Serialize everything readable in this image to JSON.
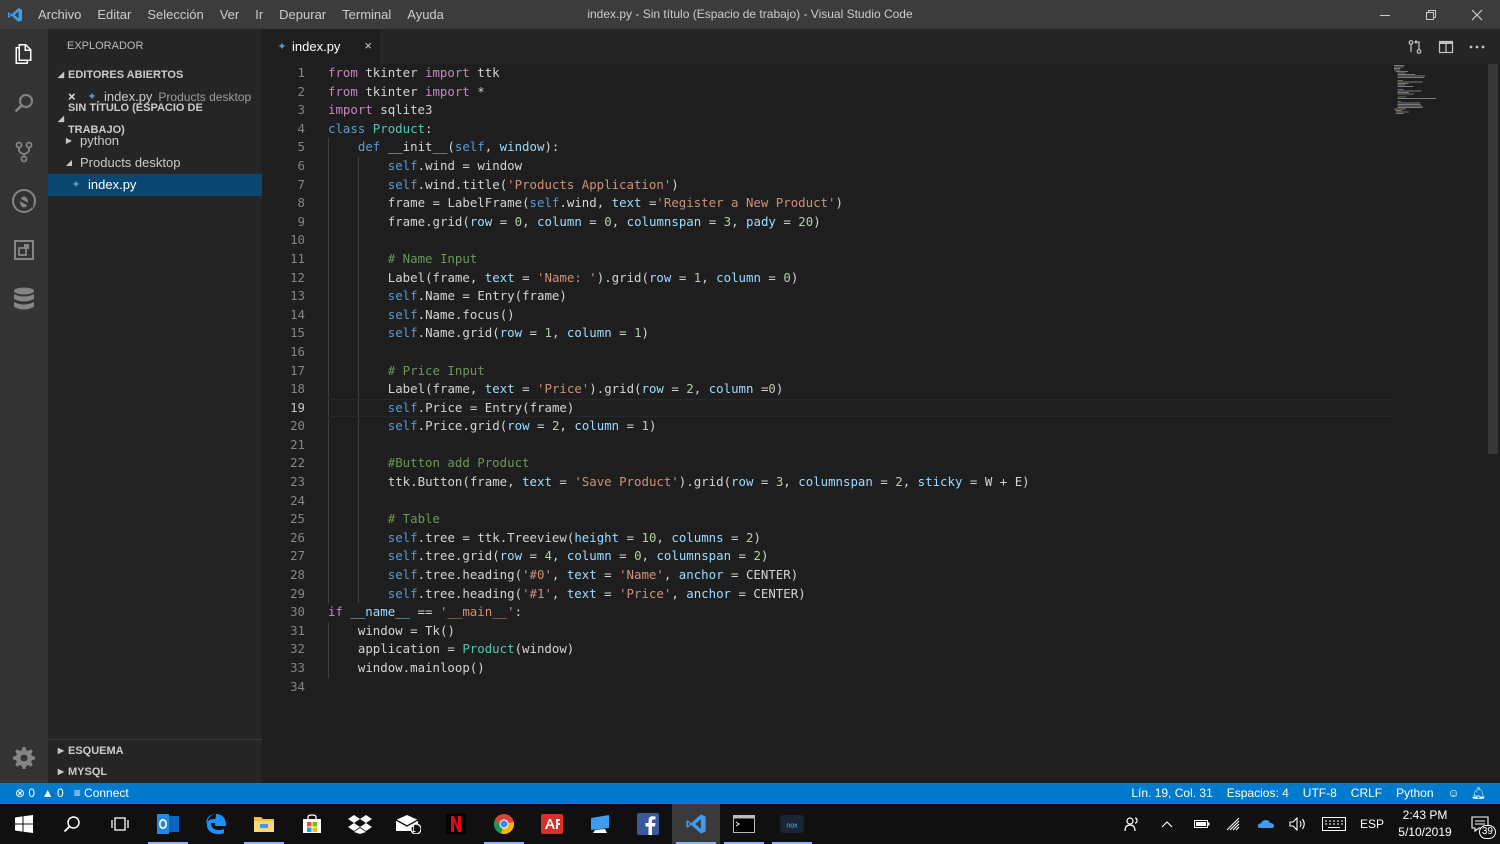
{
  "window": {
    "title": "index.py - Sin título (Espacio de trabajo) - Visual Studio Code",
    "menu": [
      "Archivo",
      "Editar",
      "Selección",
      "Ver",
      "Ir",
      "Depurar",
      "Terminal",
      "Ayuda"
    ]
  },
  "sidebar": {
    "title": "EXPLORADOR",
    "open_editors": {
      "header": "EDITORES ABIERTOS",
      "items": [
        {
          "name": "index.py",
          "description": "Products desktop"
        }
      ]
    },
    "workspace": {
      "header": "SIN TÍTULO (ESPACIO DE TRABAJO)",
      "items": [
        {
          "name": "python",
          "type": "folder",
          "expanded": false
        },
        {
          "name": "Products desktop",
          "type": "folder",
          "expanded": true
        },
        {
          "name": "index.py",
          "type": "file",
          "selected": true
        }
      ]
    },
    "bottom_sections": [
      "ESQUEMA",
      "MYSQL"
    ]
  },
  "editor": {
    "tab": {
      "label": "index.py",
      "close": "×"
    },
    "active_line": 19,
    "line_numbers": [
      "1",
      "2",
      "3",
      "4",
      "5",
      "6",
      "7",
      "8",
      "9",
      "10",
      "11",
      "12",
      "13",
      "14",
      "15",
      "16",
      "17",
      "18",
      "19",
      "20",
      "21",
      "22",
      "23",
      "24",
      "25",
      "26",
      "27",
      "28",
      "29",
      "30",
      "31",
      "32",
      "33",
      "34"
    ],
    "lines": [
      "from tkinter import ttk",
      "from tkinter import *",
      "import sqlite3",
      "class Product:",
      "    def __init__(self, window):",
      "        self.wind = window",
      "        self.wind.title('Products Application')",
      "        frame = LabelFrame(self.wind, text ='Register a New Product')",
      "        frame.grid(row = 0, column = 0, columnspan = 3, pady = 20)",
      "",
      "        # Name Input",
      "        Label(frame, text = 'Name: ').grid(row = 1, column = 0)",
      "        self.Name = Entry(frame)",
      "        self.Name.focus()",
      "        self.Name.grid(row = 1, column = 1)",
      "",
      "        # Price Input",
      "        Label(frame, text = 'Price').grid(row = 2, column =0)",
      "        self.Price = Entry(frame)",
      "        self.Price.grid(row = 2, column = 1)",
      "",
      "        #Button add Product",
      "        ttk.Button(frame, text = 'Save Product').grid(row = 3, columnspan = 2, sticky = W + E)",
      "",
      "        # Table",
      "        self.tree = ttk.Treeview(height = 10, columns = 2)",
      "        self.tree.grid(row = 4, column = 0, columnspan = 2)",
      "        self.tree.heading('#0', text = 'Name', anchor = CENTER)",
      "        self.tree.heading('#1', text = 'Price', anchor = CENTER)",
      "if __name__ == '__main__':",
      "    window = Tk()",
      "    application = Product(window)",
      "    window.mainloop()",
      ""
    ]
  },
  "statusbar": {
    "errors": "0",
    "warnings": "0",
    "connect": "Connect",
    "position": "Lín. 19, Col. 31",
    "spaces": "Espacios: 4",
    "encoding": "UTF-8",
    "eol": "CRLF",
    "language": "Python"
  },
  "taskbar": {
    "time": "2:43 PM",
    "date": "5/10/2019",
    "language": "ESP",
    "notifications": "39",
    "mail_badge": "1"
  },
  "colors": {
    "accent": "#007acc",
    "keyword": "#569cd6",
    "control": "#c586c0",
    "string": "#ce9178",
    "comment": "#6a9955",
    "number": "#b5cea8",
    "param": "#9cdcfe",
    "class": "#4ec9b0"
  },
  "icons": {
    "activitybar": [
      "explorer-icon",
      "search-icon",
      "source-control-icon",
      "debug-icon",
      "extensions-icon",
      "database-icon"
    ],
    "taskbar": [
      "windows-start-icon",
      "search-icon",
      "task-view-icon",
      "outlook-icon",
      "edge-icon",
      "file-explorer-icon",
      "store-icon",
      "dropbox-icon",
      "mail-icon",
      "netflix-icon",
      "chrome-icon",
      "acrobat-icon",
      "remote-desktop-icon",
      "facebook-icon",
      "vscode-icon",
      "terminal-icon",
      "nox-icon"
    ]
  }
}
